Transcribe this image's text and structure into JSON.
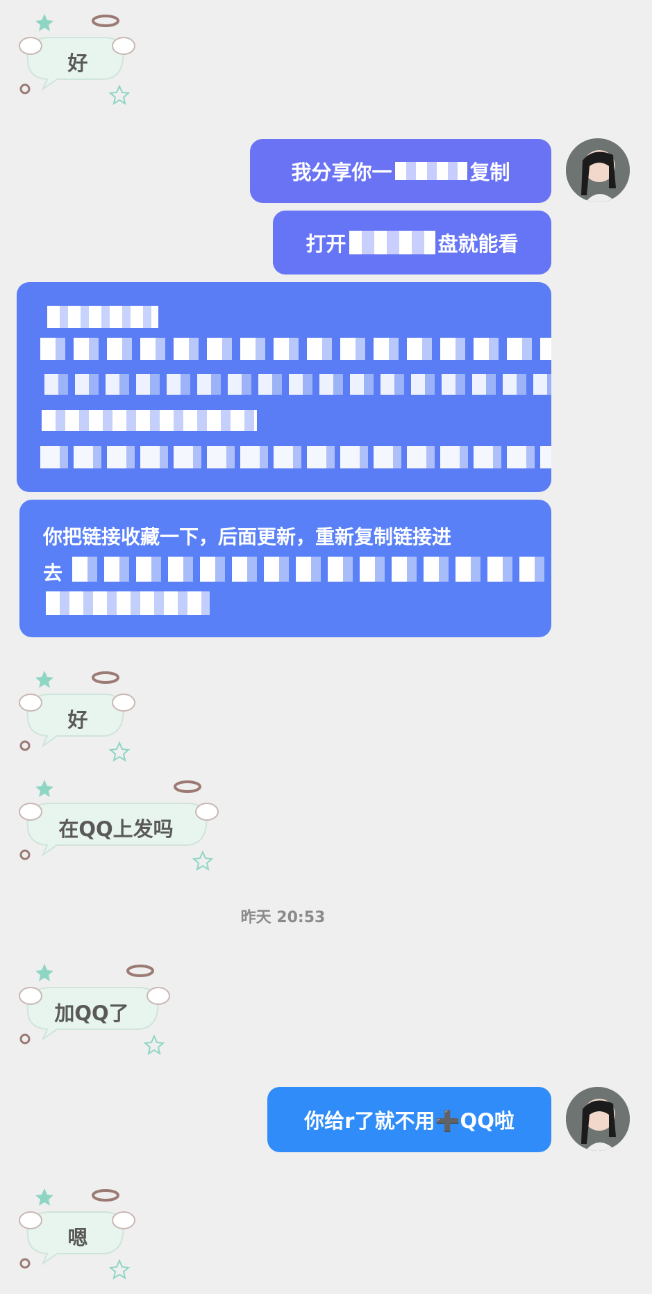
{
  "messages": [
    {
      "side": "received",
      "text": "好"
    },
    {
      "side": "sent",
      "text": "我分享你一"
    },
    {
      "side": "sent_tail_1",
      "text": "复制"
    },
    {
      "side": "sent",
      "text": "打开"
    },
    {
      "side": "sent_tail_2",
      "text": "盘就能看"
    },
    {
      "side": "sent",
      "line1": "你把链接收藏一下，后面更新，重新复制链接进",
      "line2_start": "去"
    },
    {
      "side": "received",
      "text": "好"
    },
    {
      "side": "received",
      "text": "在QQ上发吗"
    },
    {
      "side": "received",
      "text": "加QQ了"
    },
    {
      "side": "sent",
      "text": "你给r了就不用➕QQ啦"
    },
    {
      "side": "received",
      "text": "嗯"
    }
  ],
  "timestamp": "昨天 20:53",
  "colors": {
    "background": "#efefef",
    "sent_bubble_purple": "#6a73f4",
    "sent_bubble_blue": "#5a7df6",
    "sent_bubble_bright_blue": "#2f8cf9",
    "sticker_bubble": "#e8f5ee",
    "halo": "#9c7a74",
    "star": "#8fd5c4"
  },
  "icons": [
    "avatar",
    "sticker-bubble",
    "halo-icon",
    "wing-icon",
    "star-icon",
    "swirl-icon"
  ]
}
